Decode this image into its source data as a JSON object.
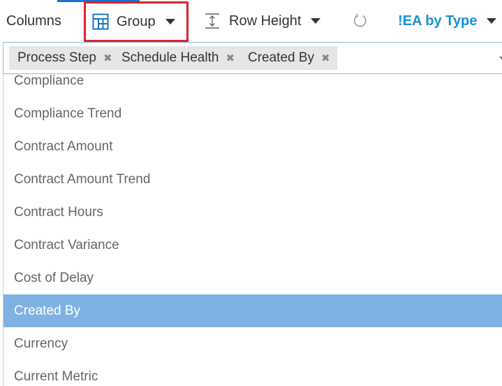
{
  "toolbar": {
    "columns_label": "Columns",
    "group_label": "Group",
    "row_height_label": "Row Height",
    "view_label": "!EA by Type"
  },
  "tags": [
    {
      "label": "Process Step"
    },
    {
      "label": "Schedule Health"
    },
    {
      "label": "Created By"
    }
  ],
  "remove_glyph": "✖",
  "options": [
    {
      "label": "Compliance"
    },
    {
      "label": "Compliance Trend"
    },
    {
      "label": "Contract Amount"
    },
    {
      "label": "Contract Amount Trend"
    },
    {
      "label": "Contract Hours"
    },
    {
      "label": "Contract Variance"
    },
    {
      "label": "Cost of Delay"
    },
    {
      "label": "Created By",
      "selected": true
    },
    {
      "label": "Currency"
    },
    {
      "label": "Current Metric"
    }
  ],
  "colors": {
    "accent": "#1a73c4",
    "highlight_border": "#d9232e",
    "view_link": "#1a8fd8",
    "selected_row": "#7fb2e2"
  }
}
